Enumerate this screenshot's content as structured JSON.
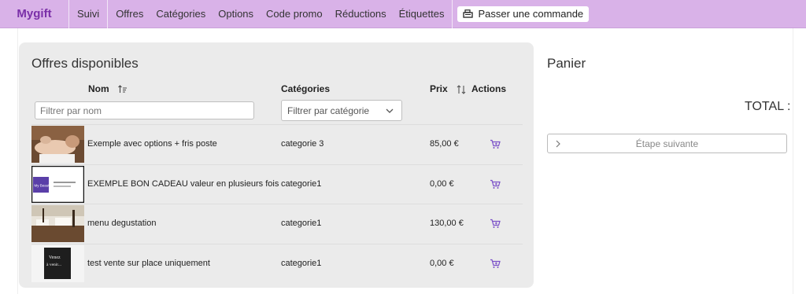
{
  "nav": {
    "brand": "Mygift",
    "suivi": "Suivi",
    "links": [
      "Offres",
      "Catégories",
      "Options",
      "Code promo",
      "Réductions",
      "Étiquettes"
    ],
    "order_button": "Passer une commande"
  },
  "offers": {
    "title": "Offres disponibles",
    "columns": {
      "name": "Nom",
      "category": "Catégories",
      "price": "Prix",
      "actions": "Actions"
    },
    "filter_name_placeholder": "Filtrer par nom",
    "filter_category_label": "Filtrer par catégorie",
    "items": [
      {
        "name": "Exemple avec options + fris poste",
        "category": "categorie 3",
        "price": "85,00 €",
        "thumb": "massage-photo"
      },
      {
        "name": "EXEMPLE BON CADEAU valeur en plusieurs fois",
        "category": "categorie1",
        "price": "0,00 €",
        "thumb": "voucher-card",
        "thumb_text": "My Beauty"
      },
      {
        "name": "menu degustation",
        "category": "categorie1",
        "price": "130,00 €",
        "thumb": "restaurant-photo"
      },
      {
        "name": "test vente sur place uniquement",
        "category": "categorie1",
        "price": "0,00 €",
        "thumb": "chalkboard",
        "thumb_text": [
          "Venez",
          "à venir..."
        ]
      }
    ]
  },
  "cart": {
    "title": "Panier",
    "total_label": "TOTAL :",
    "next_button": "Étape suivante"
  },
  "colors": {
    "nav_bg": "#d9b2e8",
    "brand": "#7a2fa8",
    "cart_icon": "#7a4fc8",
    "card_bg": "#ebebeb"
  }
}
